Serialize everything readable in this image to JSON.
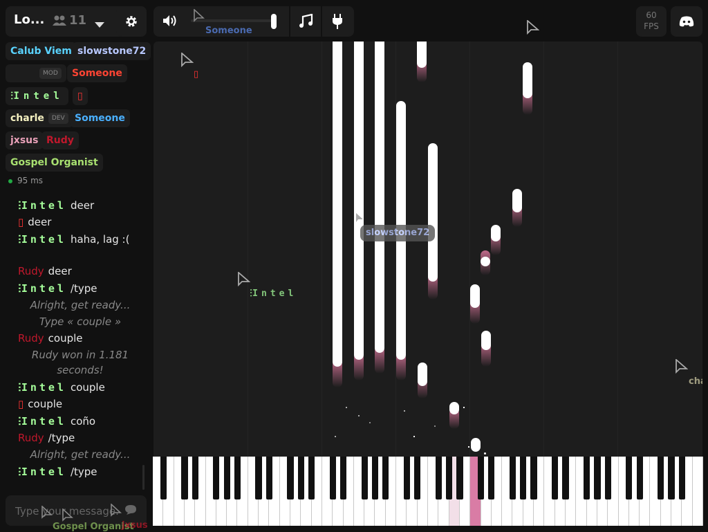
{
  "header": {
    "room_name": "Lo...",
    "user_count": "11",
    "volume_user_label": "Someone",
    "fps_value": "60",
    "fps_label": "FPS"
  },
  "icons": [
    "users-icon",
    "chevron-down-icon",
    "gear-icon",
    "volume-icon",
    "music-note-icon",
    "plug-icon",
    "discord-icon",
    "chat-bubble-icon",
    "cursor-icon"
  ],
  "colors": {
    "background": "#111111",
    "panel": "#1d1d1d",
    "note": "#ffffff",
    "note_glow": "#c06a8a",
    "pressed_key": "#d97ca5",
    "intel_color": "#a6ff9b"
  },
  "users": [
    {
      "name": "Calub Viem",
      "color": "#5ad3ff"
    },
    {
      "name": "slowstone72",
      "color": "#b8c8ff"
    },
    {
      "name": "",
      "color": "#c0182c",
      "tag": "MOD"
    },
    {
      "name": "Someone",
      "color": "#ff4433"
    },
    {
      "name": "Intel",
      "color": "#a6ff9b"
    },
    {
      "name": "▯",
      "color": "#ff3333"
    },
    {
      "name": "charle",
      "color": "#f4f0c0",
      "tag": "DEV"
    },
    {
      "name": "Someone",
      "color": "#4ab0ff"
    },
    {
      "name": "jxsus",
      "color": "#e8a0b8"
    },
    {
      "name": "Rudy",
      "color": "#c0182c"
    },
    {
      "name": "Gospel Organist",
      "color": "#a8e070"
    }
  ],
  "ping": "95 ms",
  "chat": {
    "messages": [
      {
        "user": "Intel",
        "text": "deer"
      },
      {
        "user": "▯",
        "text": "deer"
      },
      {
        "user": "Intel",
        "text": "haha, lag :("
      },
      {
        "user": "Rudy",
        "text": "deer"
      },
      {
        "user": "Intel",
        "text": "/type"
      },
      {
        "system": "Alright, get ready..."
      },
      {
        "system": "Type « couple »"
      },
      {
        "user": "Rudy",
        "text": "couple"
      },
      {
        "system": "Rudy won in 1.181 seconds!"
      },
      {
        "user": "Intel",
        "text": "couple"
      },
      {
        "user": "▯",
        "text": "couple"
      },
      {
        "user": "Intel",
        "text": "coño"
      },
      {
        "user": "Rudy",
        "text": "/type"
      },
      {
        "system": "Alright, get ready..."
      },
      {
        "user": "Intel",
        "text": "/type"
      }
    ],
    "input_placeholder": "Type your message..."
  },
  "cursors": [
    {
      "name": "",
      "color": "#c0182c"
    },
    {
      "name": "▯",
      "color": "#ff3333"
    },
    {
      "name": "slowstone72",
      "color": "#b8c8ff"
    },
    {
      "name": "Intel",
      "color": "#a6ff9b"
    },
    {
      "name": "charle",
      "color": "#f4f0c0"
    },
    {
      "name": "Gospel Organist",
      "color": "#a8e070"
    },
    {
      "name": "jxsus",
      "color": "#e8a0b8"
    }
  ]
}
